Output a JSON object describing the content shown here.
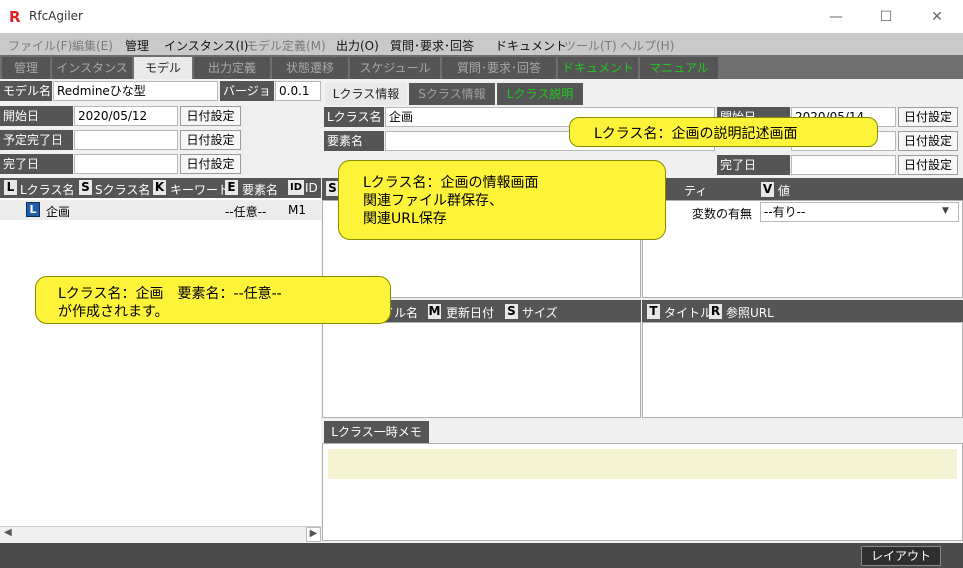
{
  "app": {
    "title": "RfcAgiler",
    "logo_letter": "R"
  },
  "window_controls": {
    "minimize": "—",
    "maximize": "☐",
    "close": "✕"
  },
  "menu": [
    {
      "label": "ファイル(F)",
      "enabled": false
    },
    {
      "label": "編集(E)",
      "enabled": false
    },
    {
      "label": "管理",
      "enabled": true
    },
    {
      "label": "インスタンス(I)",
      "enabled": true
    },
    {
      "label": "モデル定義(M)",
      "enabled": false
    },
    {
      "label": "出力(O)",
      "enabled": true
    },
    {
      "label": "質問･要求･回答",
      "enabled": true
    },
    {
      "label": "ドキュメント",
      "enabled": true
    },
    {
      "label": "ツール(T)",
      "enabled": false
    },
    {
      "label": "ヘルプ(H)",
      "enabled": false
    }
  ],
  "main_tabs": [
    "管理",
    "インスタンス",
    "モデル",
    "出力定義",
    "状態遷移",
    "スケジュール",
    "質問･要求･回答",
    "ドキュメント",
    "マニュアル"
  ],
  "active_main_tab": "モデル",
  "model": {
    "name_label": "モデル名",
    "name_value": "Redmineひな型",
    "version_label": "バージョン",
    "version_value": "0.0.1"
  },
  "dates": {
    "start_label": "開始日",
    "start_value": "2020/05/12",
    "planned_label": "予定完了日",
    "planned_value": "",
    "done_label": "完了日",
    "done_value": "",
    "set_button": "日付設定"
  },
  "list": {
    "headers": [
      {
        "key": "L",
        "label": "Lクラス名"
      },
      {
        "key": "S",
        "label": "Sクラス名"
      },
      {
        "key": "K",
        "label": "キーワード"
      },
      {
        "key": "E",
        "label": "要素名"
      },
      {
        "key": "ID",
        "label": "ID"
      }
    ],
    "rows": [
      {
        "key": "L",
        "name": "企画",
        "element": "--任意--",
        "id": "M1"
      }
    ]
  },
  "right_tabs": [
    "Lクラス情報",
    "Sクラス情報",
    "Lクラス説明"
  ],
  "lclass": {
    "name_label": "Lクラス名",
    "name_value": "企画",
    "element_label": "要素名",
    "element_value": "",
    "start_label": "開始日",
    "start_value": "2020/05/14",
    "done_label": "完了日",
    "done_value": "",
    "set_button": "日付設定"
  },
  "property": {
    "s_key": "S",
    "p_label": "ティ",
    "v_key": "V",
    "v_label": "値",
    "row_label": "変数の有無",
    "row_value": "--有り--"
  },
  "files": {
    "hdr_name": "イル名",
    "m_key": "M",
    "hdr_date": "更新日付",
    "s_key": "S",
    "hdr_size": "サイズ",
    "t_key": "T",
    "hdr_title": "タイトル",
    "r_key": "R",
    "hdr_url": "参照URL"
  },
  "memo_tab": "Lクラス一時メモ",
  "status": {
    "layout_button": "レイアウト"
  },
  "callouts": {
    "desc_screen": "Lクラス名：企画の説明記述画面",
    "info_screen": [
      "Lクラス名：企画の情報画面",
      "関連ファイル群保存、",
      "関連URL保存"
    ],
    "created": [
      "Lクラス名：企画　要素名：--任意--",
      "が作成されます。"
    ]
  },
  "colors": {
    "callout": "#fdf43a",
    "active_tab_text": "#1fc91f",
    "header_bg": "#555555"
  }
}
